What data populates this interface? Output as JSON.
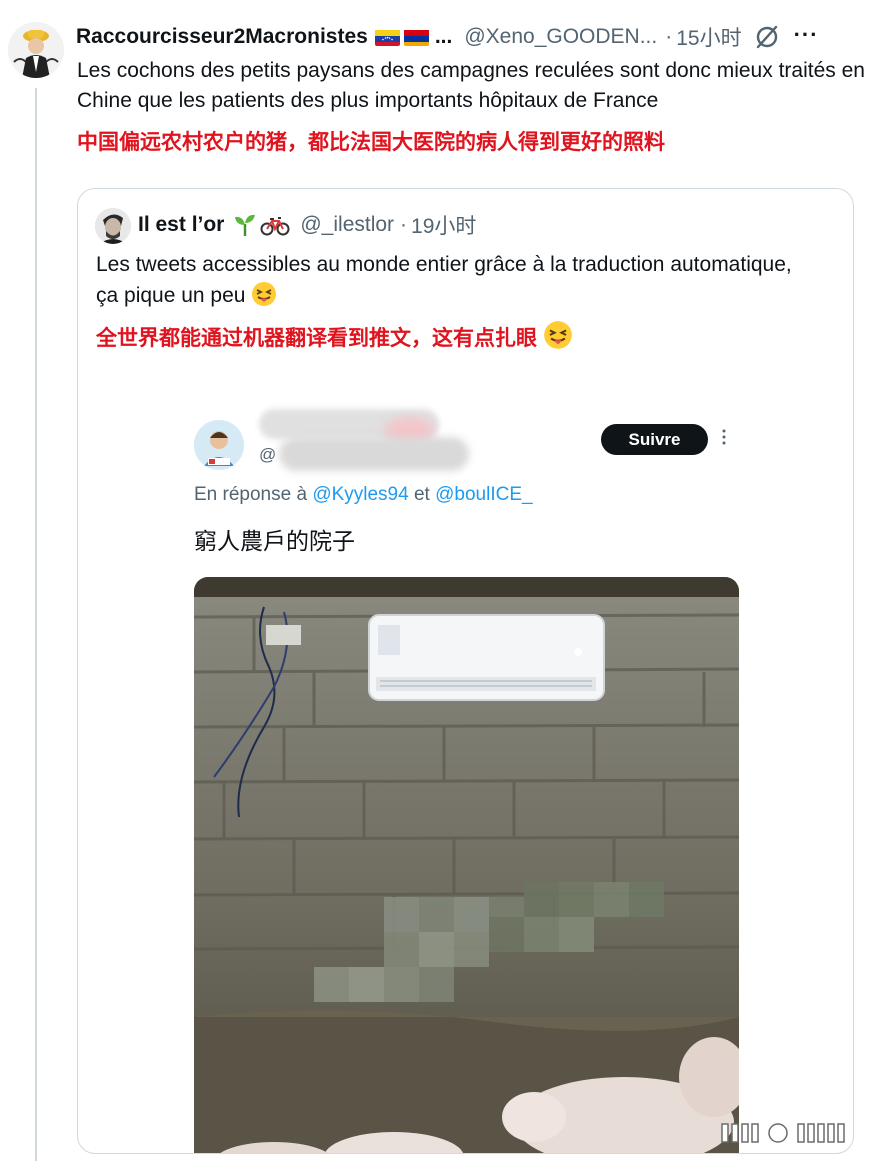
{
  "tweet": {
    "display_name": "Raccourcisseur2Macronistes",
    "flags": [
      "venezuela-flag-icon",
      "armenia-flag-icon"
    ],
    "name_ellipsis": "...",
    "handle": "@Xeno_GOODEN...",
    "dot": "·",
    "time": "15小时",
    "more": "···",
    "text": "Les cochons des petits paysans des campagnes reculées sont donc mieux traités en Chine que les patients des plus importants hôpitaux de France",
    "translation": "中国偏远农村农户的猪，都比法国大医院的病人得到更好的照料"
  },
  "quote": {
    "display_name": "Il est l’or",
    "name_emojis": [
      "seedling-icon",
      "bicycle-icon"
    ],
    "handle": "@_ilestlor",
    "dot": "·",
    "time": "19小时",
    "text": "Les tweets accessibles au monde entier grâce à la traduction automatique, ça pique un peu",
    "emoji": "squinting-tongue-emoji-icon",
    "translation": "全世界都能通过机器翻译看到推文，这有点扎眼",
    "embedded_screenshot": {
      "handle_prefix": "@",
      "follow_label": "Suivre",
      "reply_prefix": "En réponse à",
      "reply_user1": "@Kyyles94",
      "reply_and": "et",
      "reply_user2": "@boulICE_",
      "text": "窮人農戶的院子"
    }
  },
  "colors": {
    "accent_red": "#e0141e",
    "link_blue": "#1d9bf0",
    "secondary_text": "#536471",
    "border": "#cfd9de"
  }
}
